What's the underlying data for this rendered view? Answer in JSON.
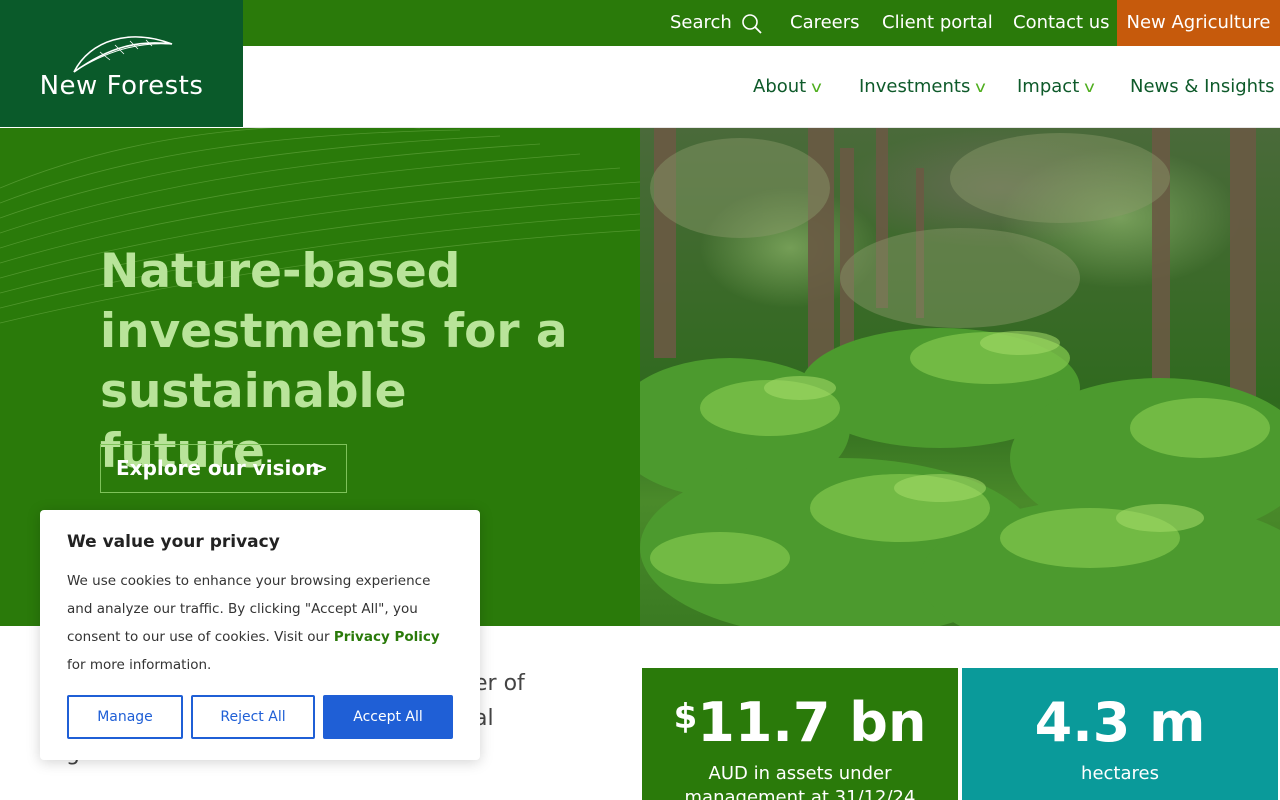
{
  "logo": {
    "text": "New Forests"
  },
  "topbar": {
    "search_label": "Search",
    "careers": "Careers",
    "client_portal": "Client portal",
    "contact_us": "Contact us",
    "new_agriculture": "New Agriculture"
  },
  "nav": {
    "items": [
      {
        "label": "About",
        "has_dropdown": true
      },
      {
        "label": "Investments",
        "has_dropdown": true
      },
      {
        "label": "Impact",
        "has_dropdown": true
      },
      {
        "label": "News & Insights",
        "has_dropdown": false
      }
    ]
  },
  "hero": {
    "title": "Nature-based investments for a sustainable future",
    "cta_label": "Explore our vision",
    "cta_arrow": ">"
  },
  "intro": {
    "line1": "er of",
    "line2": "al",
    "line3": "g"
  },
  "stats": [
    {
      "prefix": "$",
      "value": "11.7 bn",
      "label": "AUD in assets under management at 31/12/24"
    },
    {
      "prefix": "",
      "value": "4.3 m",
      "label": "hectares"
    }
  ],
  "cookie": {
    "title": "We value your privacy",
    "text_before_link": "We use cookies to enhance your browsing experience and analyze our traffic. By clicking \"Accept All\", you consent to our use of cookies. Visit our ",
    "link": "Privacy Policy",
    "text_after_link": " for more information.",
    "manage": "Manage",
    "reject": "Reject All",
    "accept": "Accept All"
  },
  "colors": {
    "brand_dark_green": "#0a5a2a",
    "brand_green": "#2a7a0a",
    "hero_text_green": "#b9e49a",
    "accent_orange": "#c65a0c",
    "teal": "#0a9a9a",
    "cookie_blue": "#1f5fd6"
  },
  "icons": {
    "search": "search-icon",
    "logo_leaf": "leaf-logo-icon",
    "dropdown": "chevron-down-icon"
  }
}
